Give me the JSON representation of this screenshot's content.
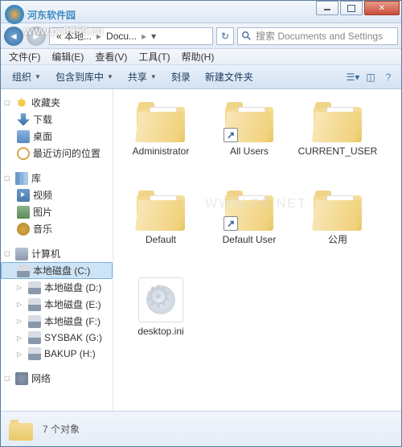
{
  "watermark": {
    "site_name": "河东软件园",
    "url": "www.pc0359.cn",
    "center": "WWW.PS.NET"
  },
  "titlebar": {},
  "nav": {
    "crumb1": "« 本地...",
    "crumb2": "Docu...",
    "search_placeholder": "搜索 Documents and Settings"
  },
  "menu": {
    "file": "文件(F)",
    "edit": "编辑(E)",
    "view": "查看(V)",
    "tools": "工具(T)",
    "help": "帮助(H)"
  },
  "toolbar": {
    "organize": "组织",
    "include": "包含到库中",
    "share": "共享",
    "burn": "刻录",
    "newfolder": "新建文件夹"
  },
  "sidebar": {
    "favorites": "收藏夹",
    "downloads": "下载",
    "desktop": "桌面",
    "recent": "最近访问的位置",
    "libraries": "库",
    "videos": "视频",
    "pictures": "图片",
    "music": "音乐",
    "computer": "计算机",
    "drive_c": "本地磁盘 (C:)",
    "drive_d": "本地磁盘 (D:)",
    "drive_e": "本地磁盘 (E:)",
    "drive_f": "本地磁盘 (F:)",
    "drive_g": "SYSBAK (G:)",
    "drive_h": "BAKUP (H:)",
    "network": "网络"
  },
  "files": [
    {
      "name": "Administrator",
      "type": "folder",
      "shortcut": false
    },
    {
      "name": "All Users",
      "type": "folder",
      "shortcut": true
    },
    {
      "name": "CURRENT_USER",
      "type": "folder",
      "shortcut": false
    },
    {
      "name": "Default",
      "type": "folder",
      "shortcut": false
    },
    {
      "name": "Default User",
      "type": "folder",
      "shortcut": true
    },
    {
      "name": "公用",
      "type": "folder",
      "shortcut": false
    },
    {
      "name": "desktop.ini",
      "type": "ini",
      "shortcut": false
    }
  ],
  "status": {
    "text": "7 个对象"
  }
}
